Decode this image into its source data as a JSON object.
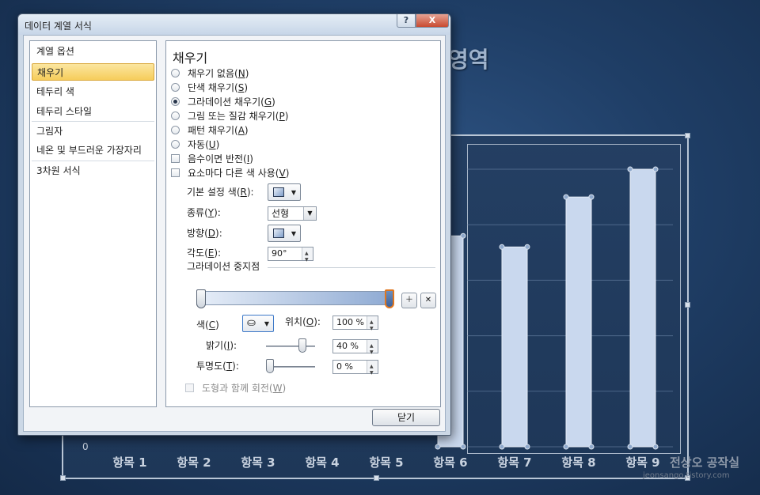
{
  "slide": {
    "title_fragment": "영역",
    "axis_zero": "0",
    "categories": [
      "항목 1",
      "항목 2",
      "항목 3",
      "항목 4",
      "항목 5",
      "항목 6",
      "항목 7",
      "항목 8",
      "항목 9"
    ],
    "watermark_main": "전상오 공작실",
    "watermark_sub": "jeonsango.tistory.com"
  },
  "chart_data": {
    "type": "bar",
    "categories": [
      "항목 1",
      "항목 2",
      "항목 3",
      "항목 4",
      "항목 5",
      "항목 6",
      "항목 7",
      "항목 8",
      "항목 9"
    ],
    "values": [
      null,
      null,
      null,
      null,
      null,
      3.8,
      3.6,
      4.5,
      5.0
    ],
    "ylim": [
      0,
      5.2
    ]
  },
  "dialog": {
    "title": "데이터 계열 서식",
    "help_label": "?",
    "close_label": "X",
    "nav": [
      {
        "label": "계열 옵션"
      },
      {
        "label": "채우기"
      },
      {
        "label": "테두리 색"
      },
      {
        "label": "테두리 스타일"
      },
      {
        "label": "그림자"
      },
      {
        "label": "네온 및 부드러운 가장자리"
      },
      {
        "label": "3차원 서식"
      }
    ],
    "section_title": "채우기",
    "fill_options": [
      {
        "label": "채우기 없음(",
        "key": "N",
        "end": ")"
      },
      {
        "label": "단색 채우기(",
        "key": "S",
        "end": ")"
      },
      {
        "label": "그라데이션 채우기(",
        "key": "G",
        "end": ")"
      },
      {
        "label": "그림 또는 질감 채우기(",
        "key": "P",
        "end": ")"
      },
      {
        "label": "패턴 채우기(",
        "key": "A",
        "end": ")"
      },
      {
        "label": "자동(",
        "key": "U",
        "end": ")"
      }
    ],
    "checkboxes": [
      {
        "label": "음수이면 반전(",
        "key": "I",
        "end": ")"
      },
      {
        "label": "요소마다 다른 색 사용(",
        "key": "V",
        "end": ")"
      }
    ],
    "preset_color_label": "기본 설정 색(",
    "preset_color_key": "R",
    "type_label": "종류(",
    "type_key": "Y",
    "type_value": "선형",
    "direction_label": "방향(",
    "direction_key": "D",
    "angle_label": "각도(",
    "angle_key": "E",
    "angle_value": "90°",
    "stops_label": "그라데이션 중지점",
    "color_label": "색(",
    "color_key": "C",
    "position_label": "위치(",
    "position_key": "O",
    "position_value": "100 %",
    "brightness_label": "밝기(",
    "brightness_key": "I",
    "brightness_value": "40 %",
    "transparency_label": "투명도(",
    "transparency_key": "T",
    "transparency_value": "0 %",
    "rotate_label": "도형과 함께 회전(",
    "rotate_key": "W",
    "close_button": "닫기",
    "selected_fill": "그라데이션 채우기",
    "brightness_level": 0.4,
    "transparency_level": 0.0
  }
}
